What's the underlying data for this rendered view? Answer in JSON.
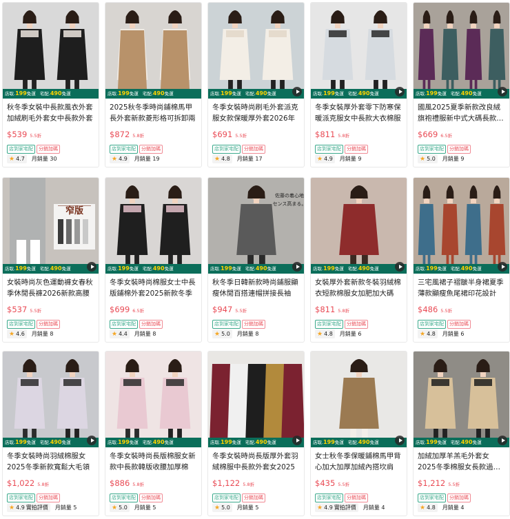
{
  "banner": {
    "pickup_prefix": "店取",
    "pickup_price": "199",
    "pickup_suffix": "免運",
    "home_prefix": "宅配",
    "home_price": "490",
    "home_suffix": "免運"
  },
  "colors": {
    "banner_bg": "#0b6e5a",
    "price_red": "#e94a54",
    "tag_green": "#3aa98b",
    "star": "#f5a623"
  },
  "products": [
    {
      "title": "秋冬季女裝中長款風衣外套加絨刷毛外套女中長款外套",
      "price": "$539",
      "discount": "5.5折",
      "tags": [
        "店到家宅配",
        "分銷加碼"
      ],
      "rating": "4.7",
      "sales_label": "月銷量",
      "sales": "30",
      "has_video": false,
      "icon": "product-photo-icon"
    },
    {
      "title": "2025秋冬季時尚鋪棉馬甲長外套新款菱形格可拆卸兩",
      "price": "$872",
      "discount": "5.8折",
      "tags": [
        "店到家宅配",
        "分銷加碼"
      ],
      "rating": "4.9",
      "sales_label": "月銷量",
      "sales": "19",
      "has_video": false,
      "icon": "product-photo-icon"
    },
    {
      "title": "冬季女裝時尚刷毛外套派克服女款保暖厚外套2026年",
      "price": "$691",
      "discount": "5.5折",
      "tags": [
        "店到家宅配",
        "分銷加碼"
      ],
      "rating": "4.8",
      "sales_label": "月銷量",
      "sales": "17",
      "has_video": true,
      "icon": "product-photo-icon"
    },
    {
      "title": "冬季女裝厚外套零下防寒保暖派克服女中長款大衣棉服",
      "price": "$811",
      "discount": "5.8折",
      "tags": [
        "店到家宅配",
        "分銷加碼"
      ],
      "rating": "4.9",
      "sales_label": "月銷量",
      "sales": "9",
      "has_video": true,
      "icon": "product-photo-icon"
    },
    {
      "title": "國風2025夏季新款改良絨旗袍禮服新中式大碼長款婚宴",
      "price": "$669",
      "discount": "6.5折",
      "tags": [
        "店到家宅配",
        "分銷加碼"
      ],
      "rating": "5.0",
      "sales_label": "月銷量",
      "sales": "9",
      "has_video": true,
      "icon": "product-photo-icon"
    },
    {
      "title": "女裝時尚灰色運動褲女春秋季休閒長褲2026新款高腰",
      "price": "$537",
      "discount": "5.5折",
      "tags": [
        "店到家宅配",
        "分銷加碼"
      ],
      "rating": "4.6",
      "sales_label": "月銷量",
      "sales": "8",
      "has_video": true,
      "photo_text": "窄版",
      "photo_sub": "LULU同款",
      "icon": "product-photo-icon"
    },
    {
      "title": "冬季女裝時尚棉服女士中長版鋪棉外套2025新款冬季",
      "price": "$699",
      "discount": "6.5折",
      "tags": [
        "店到家宅配",
        "分銷加碼"
      ],
      "rating": "4.4",
      "sales_label": "月銷量",
      "sales": "8",
      "has_video": false,
      "icon": "product-photo-icon"
    },
    {
      "title": "秋冬季日韓新款時尚鋪服顯瘦休閒百搭連帽拼接長袖",
      "price": "$947",
      "discount": "5.5折",
      "tags": [
        "店到家宅配",
        "分銷加碼"
      ],
      "rating": "5.0",
      "sales_label": "月銷量",
      "sales": "8",
      "has_video": true,
      "photo_text": "佐藤の着心地",
      "photo_sub": "センス高まる。",
      "icon": "product-photo-icon"
    },
    {
      "title": "女裝厚外套新款冬裝羽絨棉衣短款棉服女加肥加大碼",
      "price": "$811",
      "discount": "5.8折",
      "tags": [
        "店到家宅配",
        "分銷加碼"
      ],
      "rating": "4.8",
      "sales_label": "月銷量",
      "sales": "6",
      "has_video": true,
      "icon": "product-photo-icon"
    },
    {
      "title": "三宅風裙子褶皺半身裙夏季薄款顯瘦魚尾裙印花設計",
      "price": "$486",
      "discount": "5.5折",
      "tags": [
        "店到家宅配",
        "分銷加碼"
      ],
      "rating": "4.8",
      "sales_label": "月銷量",
      "sales": "6",
      "has_video": true,
      "icon": "product-photo-icon"
    },
    {
      "title": "冬季女裝時尚羽絨棉服女2025冬季新款寬鬆大毛領",
      "price": "$1,022",
      "discount": "5.8折",
      "tags": [
        "店到家宅配",
        "分銷加碼"
      ],
      "rating": "4.9",
      "rating_badge": "實拍評價",
      "sales_label": "月銷量",
      "sales": "5",
      "has_video": true,
      "icon": "product-photo-icon"
    },
    {
      "title": "冬季女裝時尚長版棉服女新款中長款韓版收腰加厚棉",
      "price": "$886",
      "discount": "5.8折",
      "tags": [
        "店到家宅配",
        "分銷加碼"
      ],
      "rating": "5.0",
      "sales_label": "月銷量",
      "sales": "5",
      "has_video": false,
      "icon": "product-photo-icon"
    },
    {
      "title": "冬季女裝時尚長版厚外套羽絨棉服中長款外套女2025",
      "price": "$1,122",
      "discount": "5.8折",
      "tags": [
        "店到家宅配",
        "分銷加碼"
      ],
      "rating": "5.0",
      "sales_label": "月銷量",
      "sales": "5",
      "has_video": true,
      "icon": "product-photo-icon"
    },
    {
      "title": "女士秋冬季保暖鋪棉馬甲背心加大加厚加絨內搭坎肩",
      "price": "$435",
      "discount": "5.5折",
      "tags": [
        "店到家宅配",
        "分銷加碼"
      ],
      "rating": "4.9",
      "rating_badge": "實拍評價",
      "sales_label": "月銷量",
      "sales": "4",
      "has_video": true,
      "icon": "product-photo-icon"
    },
    {
      "title": "加絨加厚羊羔毛外套女2025冬季棉服女長款過膝韓版",
      "price": "$1,212",
      "discount": "5.5折",
      "tags": [
        "店到家宅配",
        "分銷加碼"
      ],
      "rating": "4.8",
      "sales_label": "月銷量",
      "sales": "4",
      "has_video": true,
      "icon": "product-photo-icon"
    }
  ]
}
